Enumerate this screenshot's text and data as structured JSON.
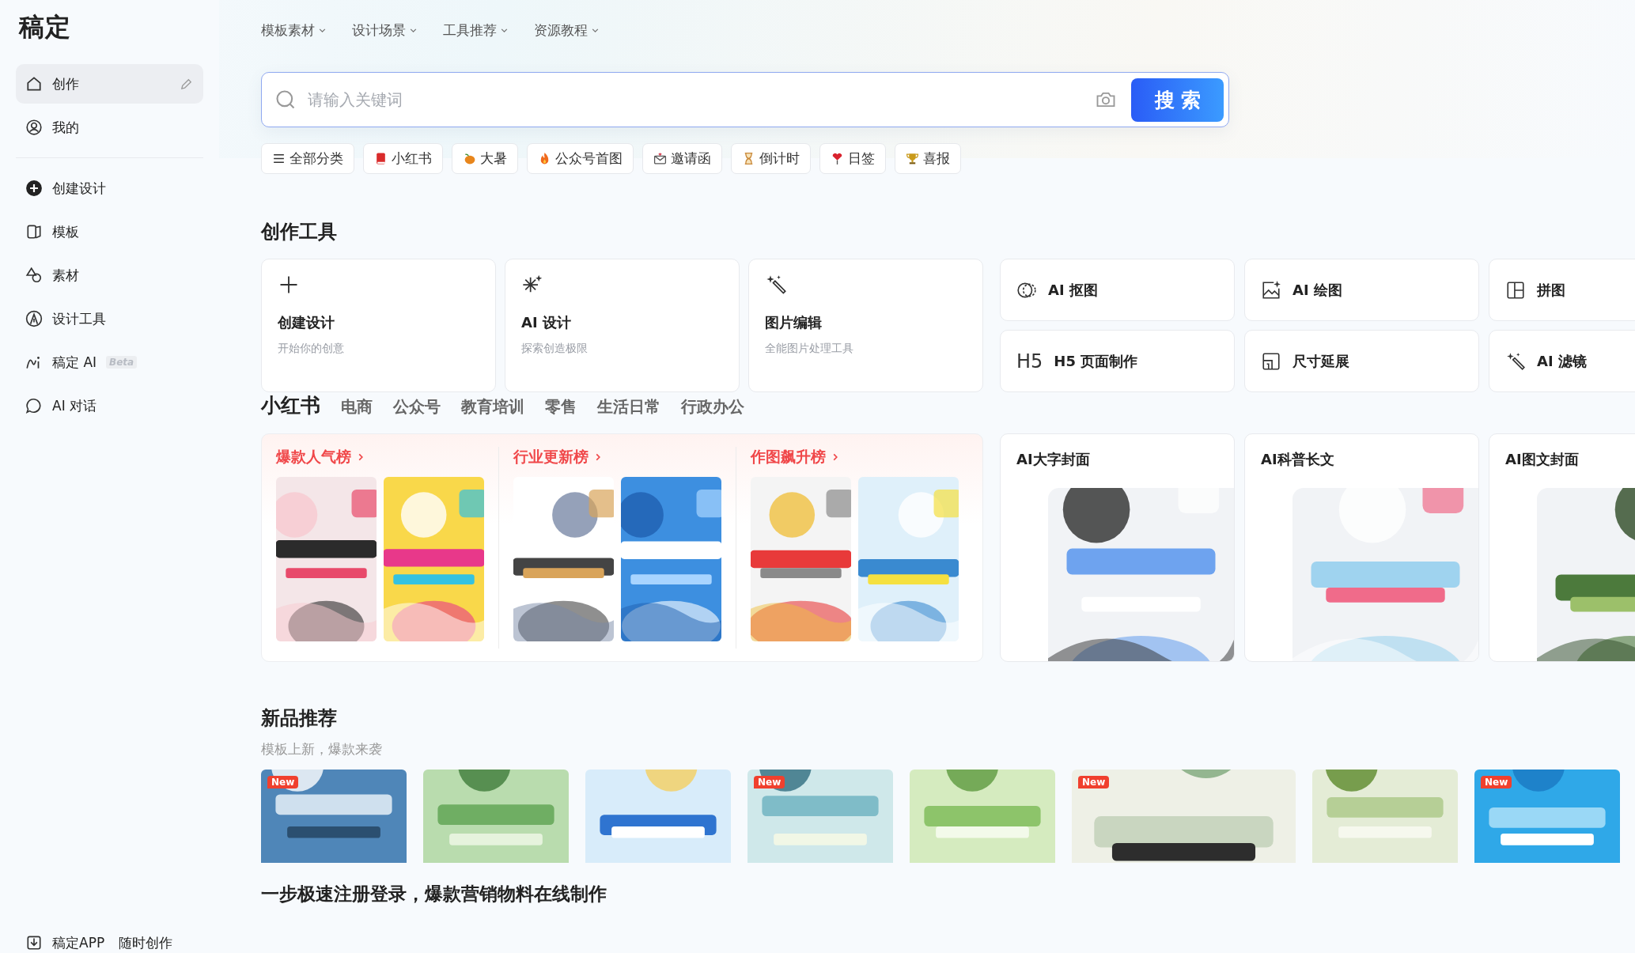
{
  "logo": "稿定",
  "sidebar": {
    "primary": [
      {
        "label": "创作",
        "selected": true
      },
      {
        "label": "我的",
        "selected": false
      }
    ],
    "secondary": [
      {
        "label": "创建设计",
        "selected": false
      },
      {
        "label": "模板",
        "selected": false
      },
      {
        "label": "素材",
        "selected": false
      },
      {
        "label": "设计工具",
        "selected": false
      },
      {
        "label": "稿定 AI",
        "badge": "Beta",
        "selected": false
      },
      {
        "label": "AI 对话",
        "selected": false
      }
    ],
    "footer": {
      "label": "稿定APP",
      "tagline": "随时创作"
    }
  },
  "top_nav": [
    "模板素材",
    "设计场景",
    "工具推荐",
    "资源教程"
  ],
  "search": {
    "placeholder": "请输入关键词",
    "button": "搜索"
  },
  "quick_tags": [
    "全部分类",
    "小红书",
    "大暑",
    "公众号首图",
    "邀请函",
    "倒计时",
    "日签",
    "喜报"
  ],
  "tools": {
    "title": "创作工具",
    "featured": [
      {
        "title": "创建设计",
        "subtitle": "开始你的创意"
      },
      {
        "title": "AI 设计",
        "subtitle": "探索创造极限"
      },
      {
        "title": "图片编辑",
        "subtitle": "全能图片处理工具"
      }
    ],
    "quick": [
      {
        "label": "AI 抠图"
      },
      {
        "label": "AI 绘图"
      },
      {
        "label": "拼图"
      },
      {
        "label": "H5 页面制作",
        "icon_text": "H5"
      },
      {
        "label": "尺寸延展"
      },
      {
        "label": "AI 滤镜"
      }
    ]
  },
  "scenes": {
    "tabs": [
      {
        "label": "小红书",
        "selected": true
      },
      {
        "label": "电商",
        "selected": false
      },
      {
        "label": "公众号",
        "selected": false
      },
      {
        "label": "教育培训",
        "selected": false
      },
      {
        "label": "零售",
        "selected": false
      },
      {
        "label": "生活日常",
        "selected": false
      },
      {
        "label": "行政办公",
        "selected": false
      }
    ],
    "rankings": [
      {
        "title": "爆款人气榜"
      },
      {
        "title": "行业更新榜"
      },
      {
        "title": "作图飙升榜"
      }
    ],
    "ai_cards": [
      {
        "title": "AI大字封面"
      },
      {
        "title": "AI科普长文"
      },
      {
        "title": "AI图文封面"
      }
    ]
  },
  "new_products": {
    "title": "新品推荐",
    "subtitle": "模板上新，爆款来袭",
    "items": [
      {
        "kind": "picture",
        "badge": "New"
      },
      {
        "kind": "picture"
      },
      {
        "kind": "picture"
      },
      {
        "kind": "picture",
        "badge": "New"
      },
      {
        "kind": "picture"
      },
      {
        "kind": "picture",
        "badge": "New"
      },
      {
        "kind": "picture"
      },
      {
        "kind": "picture",
        "badge": "New"
      }
    ]
  },
  "promo_heading": "一步极速注册登录，爆款营销物料在线制作"
}
